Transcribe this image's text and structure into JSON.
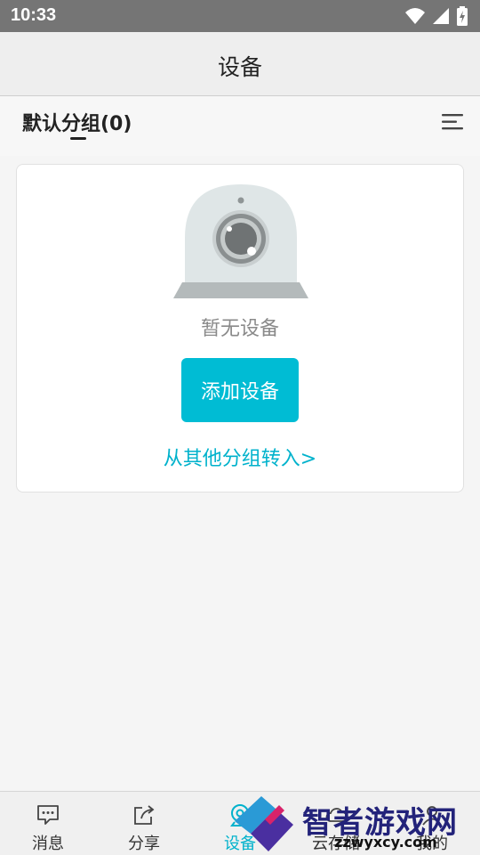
{
  "status_bar": {
    "time": "10:33"
  },
  "header": {
    "title": "设备"
  },
  "group": {
    "title": "默认分组(0)"
  },
  "empty_state": {
    "message": "暂无设备",
    "add_button": "添加设备",
    "move_link": "从其他分组转入>"
  },
  "tabs": [
    {
      "label": "消息",
      "icon": "message-icon"
    },
    {
      "label": "分享",
      "icon": "share-icon"
    },
    {
      "label": "设备",
      "icon": "device-icon",
      "active": true
    },
    {
      "label": "云存储",
      "icon": "cloud-icon"
    },
    {
      "label": "我的",
      "icon": "profile-icon"
    }
  ],
  "watermark": {
    "brand": "智者游戏网",
    "url": "zzwyxcy.com"
  },
  "colors": {
    "accent": "#00bcd4",
    "link": "#00b2cc",
    "status_bar": "#757575"
  }
}
